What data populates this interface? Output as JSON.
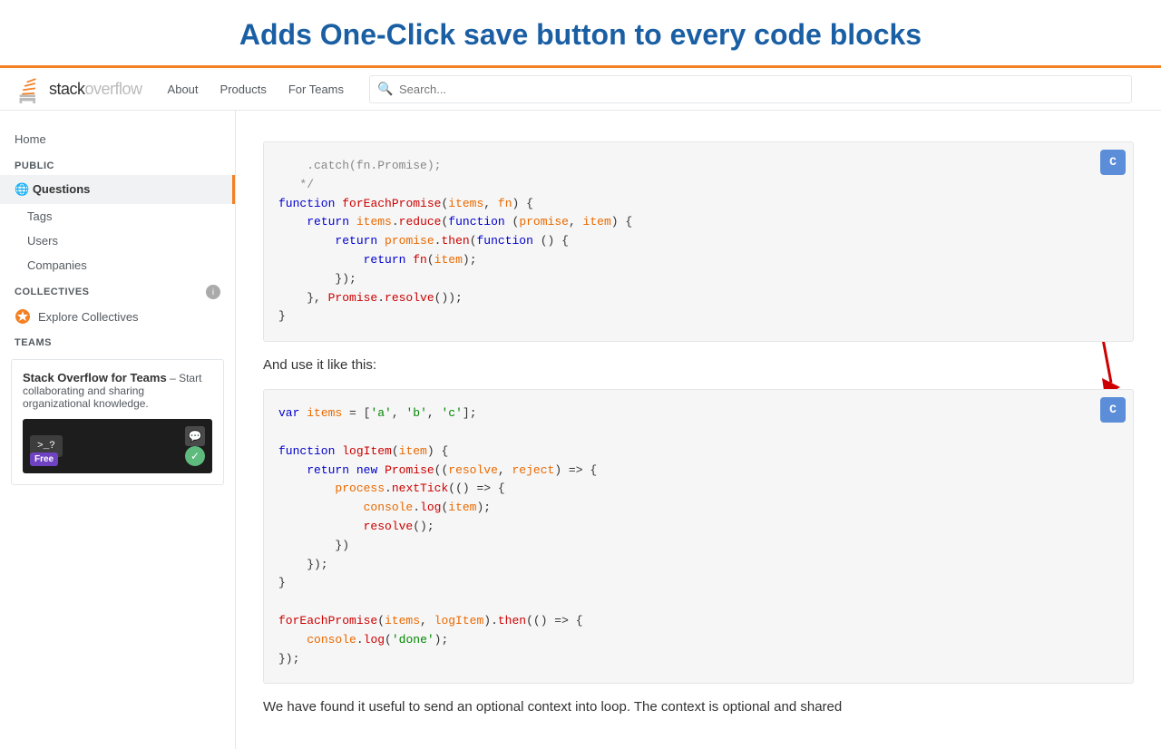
{
  "page": {
    "title": "Adds One-Click save button to every code blocks"
  },
  "nav": {
    "logo_text": "stack",
    "logo_text2": "overflow",
    "links": [
      "About",
      "Products",
      "For Teams"
    ],
    "search_placeholder": "Search..."
  },
  "sidebar": {
    "home_label": "Home",
    "public_label": "PUBLIC",
    "questions_label": "Questions",
    "tags_label": "Tags",
    "users_label": "Users",
    "companies_label": "Companies",
    "collectives_label": "COLLECTIVES",
    "explore_collectives_label": "Explore Collectives",
    "teams_label": "TEAMS",
    "teams_promo_title": "Stack Overflow for Teams",
    "teams_promo_dash": "–",
    "teams_promo_text": " Start collaborating and sharing organizational knowledge.",
    "terminal_text": ">_?",
    "free_label": "Free"
  },
  "content": {
    "use_it_text": "And use it like this:",
    "bottom_text": "We have found it useful to send an optional context into loop. The context is optional and shared",
    "code_block_1": {
      "lines": [
        {
          "type": "comment",
          "text": "    .catch(fn.Promise);"
        },
        {
          "type": "comment",
          "text": "   */"
        },
        {
          "type": "code",
          "text": "function forEachPromise(items, fn) {"
        },
        {
          "type": "code",
          "text": "    return items.reduce(function (promise, item) {"
        },
        {
          "type": "code",
          "text": "        return promise.then(function () {"
        },
        {
          "type": "code",
          "text": "            return fn(item);"
        },
        {
          "type": "code",
          "text": "        });"
        },
        {
          "type": "code",
          "text": "    }, Promise.resolve());"
        },
        {
          "type": "code",
          "text": "}"
        }
      ]
    },
    "code_block_2": {
      "lines": [
        {
          "type": "code",
          "text": "var items = ['a', 'b', 'c'];"
        },
        {
          "type": "blank"
        },
        {
          "type": "code",
          "text": "function logItem(item) {"
        },
        {
          "type": "code",
          "text": "    return new Promise((resolve, reject) => {"
        },
        {
          "type": "code",
          "text": "        process.nextTick(() => {"
        },
        {
          "type": "code",
          "text": "            console.log(item);"
        },
        {
          "type": "code",
          "text": "            resolve();"
        },
        {
          "type": "code",
          "text": "        })"
        },
        {
          "type": "code",
          "text": "    });"
        },
        {
          "type": "code",
          "text": "}"
        },
        {
          "type": "blank"
        },
        {
          "type": "code",
          "text": "forEachPromise(items, logItem).then(() => {"
        },
        {
          "type": "code",
          "text": "    console.log('done');"
        },
        {
          "type": "code",
          "text": "});"
        }
      ]
    },
    "copy_btn_label": "C"
  }
}
